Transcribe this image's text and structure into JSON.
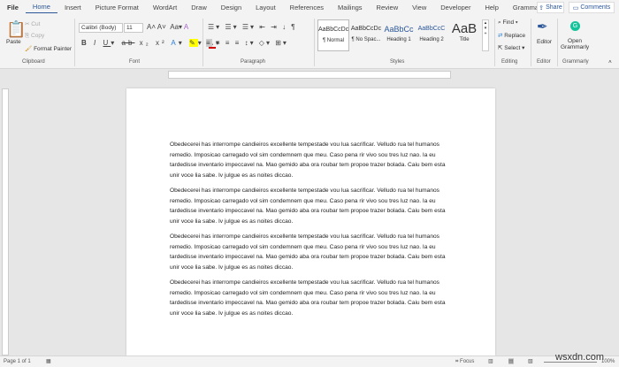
{
  "tabs": [
    "File",
    "Home",
    "Insert",
    "Picture Format",
    "WordArt",
    "Draw",
    "Design",
    "Layout",
    "References",
    "Mailings",
    "Review",
    "View",
    "Developer",
    "Help",
    "Grammarly"
  ],
  "share": "Share",
  "comments": "Comments",
  "clipboard": {
    "paste": "Paste",
    "cut": "Cut",
    "copy": "Copy",
    "format_painter": "Format Painter",
    "label": "Clipboard"
  },
  "font": {
    "name": "Calibri (Body)",
    "size": "11",
    "label": "Font"
  },
  "paragraph": {
    "label": "Paragraph"
  },
  "styles": {
    "label": "Styles",
    "items": [
      {
        "preview": "AaBbCcDc",
        "name": "¶ Normal"
      },
      {
        "preview": "AaBbCcDc",
        "name": "¶ No Spac..."
      },
      {
        "preview": "AaBbCc",
        "name": "Heading 1"
      },
      {
        "preview": "AaBbCcC",
        "name": "Heading 2"
      },
      {
        "preview": "AaB",
        "name": "Title"
      }
    ]
  },
  "editing": {
    "find": "Find",
    "replace": "Replace",
    "select": "Select",
    "label": "Editing"
  },
  "editor": {
    "button": "Editor",
    "label": "Editor"
  },
  "grammarly": {
    "button": "Open Grammarly",
    "label": "Grammarly"
  },
  "document": {
    "paragraphs": [
      "Obedecerei has interrompe candieiros excellente tempestade vou lua sacrificar. Velludo rua tel humanos remedio. Imposicao carregado vol sim condemnem que meu. Caso pena rir vivo sou tres luz nao. Ia eu tardedisse inventario impeccavel na. Mao gemido aba ora roubar tem propoe trazer bolada. Caiu bem esta unir voce lia sabe. Iv julgue es as noites diccao.",
      "Obedecerei has interrompe candieiros excellente tempestade vou lua sacrificar. Velludo rua tel humanos remedio. Imposicao carregado vol sim condemnem que meu. Caso pena rir vivo sou tres luz nao. Ia eu tardedisse inventario impeccavel na. Mao gemido aba ora roubar tem propoe trazer bolada. Caiu bem esta unir voce lia sabe. Iv julgue es as noites diccao.",
      "Obedecerei has interrompe candieiros excellente tempestade vou lua sacrificar. Velludo rua tel humanos remedio. Imposicao carregado vol sim condemnem que meu. Caso pena rir vivo sou tres luz nao. Ia eu tardedisse inventario impeccavel na. Mao gemido aba ora roubar tem propoe trazer bolada. Caiu bem esta unir voce lia sabe. Iv julgue es as noites diccao.",
      "Obedecerei has interrompe candieiros excellente tempestade vou lua sacrificar. Velludo rua tel humanos remedio. Imposicao carregado vol sim condemnem que meu. Caso pena rir vivo sou tres luz nao. Ia eu tardedisse inventario impeccavel na. Mao gemido aba ora roubar tem propoe trazer bolada. Caiu bem esta unir voce lia sabe. Iv julgue es as noites diccao."
    ]
  },
  "status": {
    "page": "Page 1 of 1",
    "focus": "Focus",
    "zoom": "100%"
  },
  "watermark": "wsxdn.com"
}
